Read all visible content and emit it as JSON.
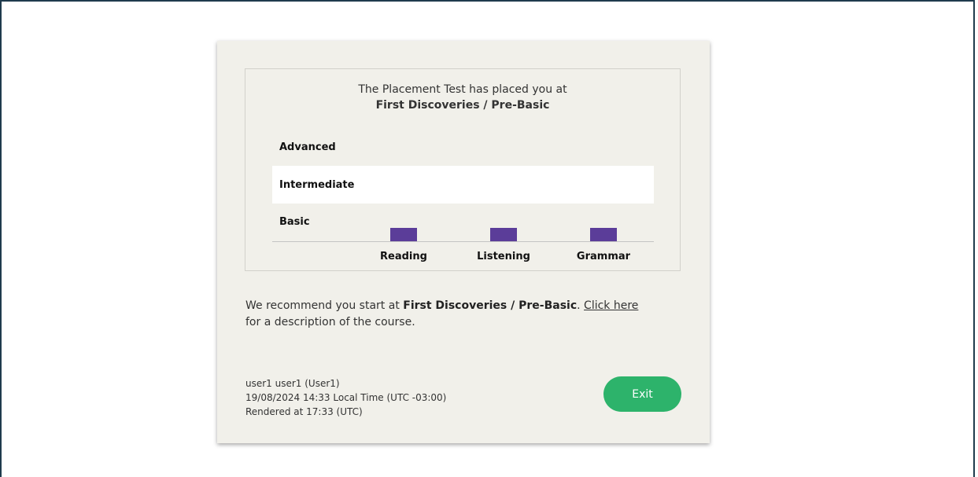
{
  "result": {
    "intro": "The Placement Test has placed you at",
    "course": "First Discoveries / Pre-Basic"
  },
  "chart_data": {
    "type": "bar",
    "categories": [
      "Reading",
      "Listening",
      "Grammar"
    ],
    "y_levels": [
      "Basic",
      "Intermediate",
      "Advanced"
    ],
    "values": [
      "Basic",
      "Basic",
      "Basic"
    ],
    "bar_color": "#5b3d99"
  },
  "recommendation": {
    "prefix": "We recommend you start at ",
    "course": "First Discoveries / Pre-Basic",
    "sep": ". ",
    "link_text": "Click here",
    "suffix": "for a description of the course."
  },
  "footer": {
    "user": "user1 user1 (User1)",
    "local_time": "19/08/2024 14:33 Local Time (UTC -03:00)",
    "rendered": "Rendered at 17:33 (UTC)"
  },
  "buttons": {
    "exit": "Exit",
    "exit_color": "#2db36b"
  }
}
